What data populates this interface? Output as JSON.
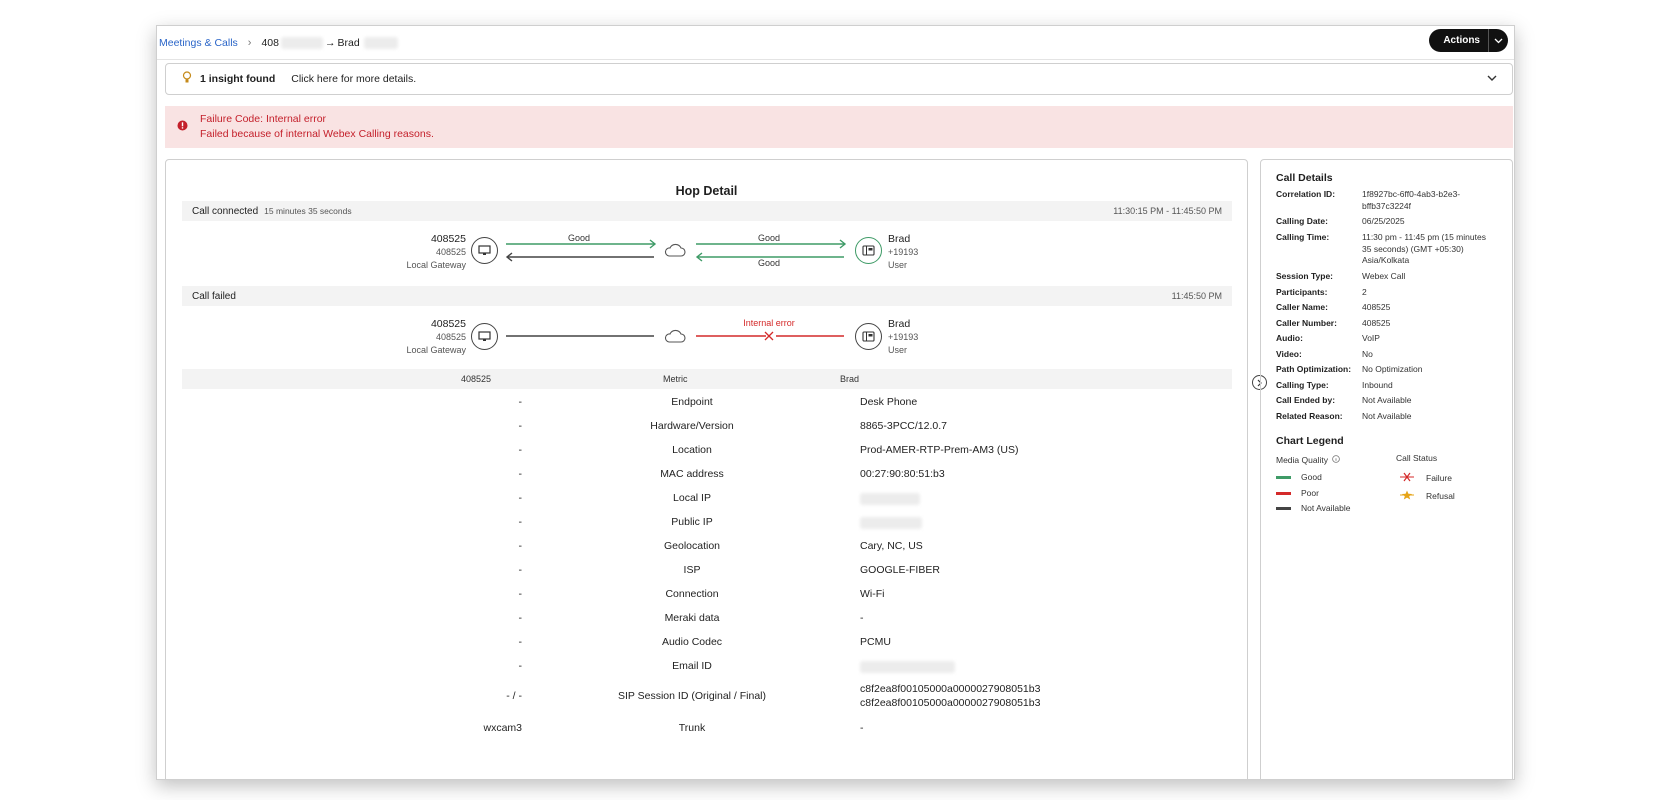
{
  "breadcrumb": {
    "root": "Meetings & Calls",
    "caller_prefix": "408",
    "arrow": "→",
    "callee": "Brad"
  },
  "actions_label": "Actions",
  "insight": {
    "title": "1 insight found",
    "detail": "Click here for more details."
  },
  "error": {
    "code_label": "Failure Code:  Internal error",
    "message": "Failed because of internal Webex Calling reasons."
  },
  "hop": {
    "title": "Hop Detail",
    "sections": [
      {
        "status": "Call connected",
        "duration": "15 minutes 35 seconds",
        "time": "11:30:15 PM - 11:45:50 PM",
        "left": {
          "name": "408525",
          "number": "408525",
          "role": "Local Gateway"
        },
        "right": {
          "name": "Brad",
          "number": "+19193",
          "role": "User"
        },
        "labels": {
          "left_top": "Good",
          "right_top": "Good",
          "right_bottom": "Good"
        }
      },
      {
        "status": "Call failed",
        "duration": "",
        "time": "11:45:50 PM",
        "left": {
          "name": "408525",
          "number": "408525",
          "role": "Local Gateway"
        },
        "right": {
          "name": "Brad",
          "number": "+19193",
          "role": "User"
        },
        "labels": {
          "right_top": "Internal error"
        }
      }
    ],
    "metric_header": {
      "left": "408525",
      "middle": "Metric",
      "right": "Brad"
    },
    "metrics": [
      {
        "left": "-",
        "name": "Endpoint",
        "right": "Desk Phone"
      },
      {
        "left": "-",
        "name": "Hardware/Version",
        "right": "8865-3PCC/12.0.7"
      },
      {
        "left": "-",
        "name": "Location",
        "right": "Prod-AMER-RTP-Prem-AM3 (US)"
      },
      {
        "left": "-",
        "name": "MAC address",
        "right": "00:27:90:80:51:b3"
      },
      {
        "left": "-",
        "name": "Local IP",
        "right": ""
      },
      {
        "left": "-",
        "name": "Public IP",
        "right": ""
      },
      {
        "left": "-",
        "name": "Geolocation",
        "right": "Cary, NC, US"
      },
      {
        "left": "-",
        "name": "ISP",
        "right": "GOOGLE-FIBER"
      },
      {
        "left": "-",
        "name": "Connection",
        "right": "Wi-Fi"
      },
      {
        "left": "-",
        "name": "Meraki data",
        "right": "-"
      },
      {
        "left": "-",
        "name": "Audio Codec",
        "right": "PCMU"
      },
      {
        "left": "-",
        "name": "Email ID",
        "right": ""
      },
      {
        "left": "- / -",
        "name": "SIP Session ID (Original / Final)",
        "right": "c8f2ea8f00105000a0000027908051b3",
        "right2": "c8f2ea8f00105000a0000027908051b3"
      },
      {
        "left": "wxcam3",
        "name": "Trunk",
        "right": "-"
      }
    ]
  },
  "call_details": {
    "title": "Call Details",
    "items": [
      {
        "k": "Correlation ID:",
        "v": "1f8927bc-6ff0-4ab3-b2e3-bffb37c3224f"
      },
      {
        "k": "Calling Date:",
        "v": "06/25/2025"
      },
      {
        "k": "Calling Time:",
        "v": "11:30 pm - 11:45 pm (15 minutes 35 seconds) (GMT +05:30) Asia/Kolkata"
      },
      {
        "k": "Session Type:",
        "v": "Webex Call"
      },
      {
        "k": "Participants:",
        "v": "2"
      },
      {
        "k": "Caller Name:",
        "v": "408525"
      },
      {
        "k": "Caller Number:",
        "v": "408525"
      },
      {
        "k": "Audio:",
        "v": "VoIP"
      },
      {
        "k": "Video:",
        "v": "No"
      },
      {
        "k": "Path Optimization:",
        "v": "No Optimization"
      },
      {
        "k": "Calling Type:",
        "v": "Inbound"
      },
      {
        "k": "Call Ended by:",
        "v": "Not Available"
      },
      {
        "k": "Related Reason:",
        "v": "Not Available"
      }
    ]
  },
  "legend": {
    "title": "Chart Legend",
    "media_quality": "Media Quality",
    "call_status": "Call Status",
    "good": "Good",
    "poor": "Poor",
    "na": "Not Available",
    "failure": "Failure",
    "refusal": "Refusal",
    "colors": {
      "good": "#3f9b67",
      "poor": "#d42a2a",
      "na": "#444444"
    }
  }
}
